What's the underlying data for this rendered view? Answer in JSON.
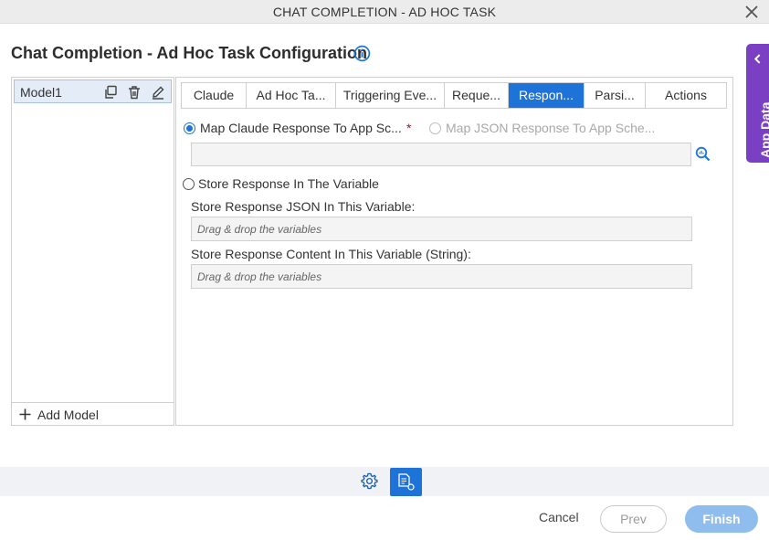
{
  "window": {
    "title": "CHAT COMPLETION - AD HOC TASK"
  },
  "page": {
    "title": "Chat Completion - Ad Hoc Task Configuration"
  },
  "app_data_tab": {
    "label": "App Data"
  },
  "models": {
    "items": [
      {
        "label": "Model1"
      }
    ],
    "add_label": "Add Model"
  },
  "tabs": [
    {
      "label": "Claude",
      "active": false
    },
    {
      "label": "Ad Hoc Ta...",
      "active": false
    },
    {
      "label": "Triggering Eve...",
      "active": false
    },
    {
      "label": "Reque...",
      "active": false
    },
    {
      "label": "Respon...",
      "active": true
    },
    {
      "label": "Parsi...",
      "active": false
    },
    {
      "label": "Actions",
      "active": false
    }
  ],
  "response": {
    "map_claude_label": "Map Claude Response To App Sc...",
    "map_claude_selected": true,
    "required_mark": "*",
    "map_json_label": "Map JSON Response To App Sche...",
    "map_json_enabled": false,
    "schema_value": "",
    "store_variable_label": "Store Response In The Variable",
    "store_variable_selected": false,
    "json_var_label": "Store Response JSON In This Variable:",
    "json_var_placeholder": "Drag & drop the variables",
    "content_var_label": "Store Response Content In This Variable (String):",
    "content_var_placeholder": "Drag & drop the variables"
  },
  "footer": {
    "cancel_label": "Cancel",
    "prev_label": "Prev",
    "finish_label": "Finish"
  },
  "icons": {
    "close": "close-icon",
    "info": "info-icon",
    "copy": "copy-icon",
    "delete": "trash-icon",
    "edit": "pencil-icon",
    "add": "plus-icon",
    "lookup": "search-icon",
    "settings": "gear-icon",
    "document": "document-icon"
  },
  "colors": {
    "accent": "#1e73d8",
    "app_data": "#7b3fc4",
    "required": "#d0021b",
    "finish_disabled": "#8fbdee"
  }
}
